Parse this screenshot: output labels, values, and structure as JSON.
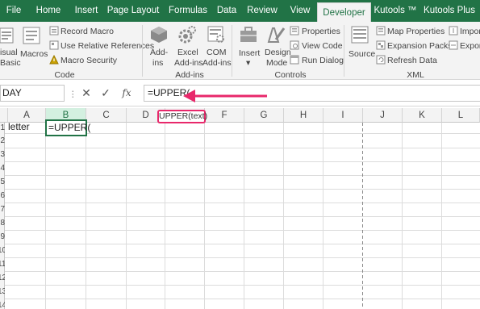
{
  "tabs": [
    "File",
    "Home",
    "Insert",
    "Page Layout",
    "Formulas",
    "Data",
    "Review",
    "View",
    "Developer",
    "Kutools ™",
    "Kutools Plus"
  ],
  "active_tab": "Developer",
  "ribbon": {
    "code": {
      "visual_basic_line1": "isual",
      "visual_basic_line2": "Basic",
      "macros": "Macros",
      "record_macro": "Record Macro",
      "use_relative_references": "Use Relative References",
      "macro_security": "Macro Security",
      "group_label": "Code"
    },
    "addins": {
      "addins_line1": "Add-",
      "addins_line2": "ins",
      "excel_addins_line1": "Excel",
      "excel_addins_line2": "Add-ins",
      "com_addins_line1": "COM",
      "com_addins_line2": "Add-ins",
      "group_label": "Add-ins"
    },
    "controls": {
      "insert": "Insert",
      "design_mode_line1": "Design",
      "design_mode_line2": "Mode",
      "properties": "Properties",
      "view_code": "View Code",
      "run_dialog": "Run Dialog",
      "group_label": "Controls"
    },
    "xml": {
      "source": "Source",
      "map_properties": "Map Properties",
      "expansion_packs": "Expansion Packs",
      "refresh_data": "Refresh Data",
      "import": "Import",
      "export": "Export",
      "group_label": "XML"
    }
  },
  "formula_bar": {
    "name_box": "DAY",
    "cancel_icon": "✕",
    "enter_icon": "✓",
    "fx_label": "fx",
    "formula": "=UPPER("
  },
  "columns": [
    "A",
    "B",
    "C",
    "D",
    "E",
    "F",
    "G",
    "H",
    "I",
    "J",
    "K",
    "L"
  ],
  "selected_column": "B",
  "row_numbers": [
    "1",
    "2",
    "3",
    "4",
    "5",
    "6",
    "7",
    "8",
    "9",
    "10",
    "11",
    "12",
    "13",
    "14"
  ],
  "cells": {
    "a1": "letter",
    "b1": "=UPPER("
  },
  "tooltip": "UPPER(text)",
  "colors": {
    "excel_green": "#217346",
    "highlight": "#e8286b"
  }
}
